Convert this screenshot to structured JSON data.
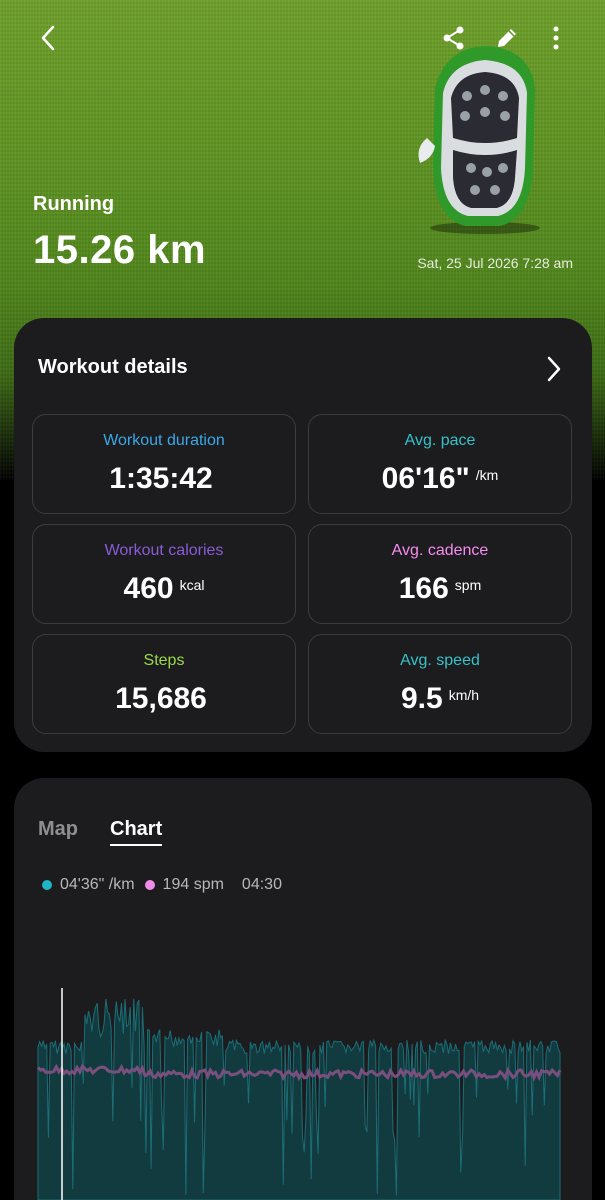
{
  "header": {
    "activity": "Running",
    "distance": "15.26 km",
    "date": "Sat, 25 Jul 2026 7:28 am",
    "icons": [
      "back-icon",
      "share-icon",
      "edit-icon",
      "more-icon"
    ]
  },
  "workout": {
    "title": "Workout details",
    "tiles": [
      {
        "label": "Workout duration",
        "value": "1:35:42",
        "unit": "",
        "color": "#3aa8e8"
      },
      {
        "label": "Avg. pace",
        "value": "06'16\"",
        "unit": "/km",
        "color": "#35c2c9"
      },
      {
        "label": "Workout calories",
        "value": "460",
        "unit": "kcal",
        "color": "#8a5bd6"
      },
      {
        "label": "Avg. cadence",
        "value": "166",
        "unit": "spm",
        "color": "#f58cf0"
      },
      {
        "label": "Steps",
        "value": "15,686",
        "unit": "",
        "color": "#9bd84a"
      },
      {
        "label": "Avg. speed",
        "value": "9.5",
        "unit": "km/h",
        "color": "#35c2c9"
      }
    ]
  },
  "chart_section": {
    "tabs": {
      "map": "Map",
      "chart": "Chart"
    },
    "active_tab": "Chart",
    "legend": {
      "pace": "04'36\" /km",
      "cadence": "194 spm",
      "time": "04:30"
    },
    "colors": {
      "pace": "#1fb5c4",
      "cadence": "#f08ce8",
      "pace_fill": "#123b40",
      "cadence_line": "#7a4f7e"
    }
  }
}
